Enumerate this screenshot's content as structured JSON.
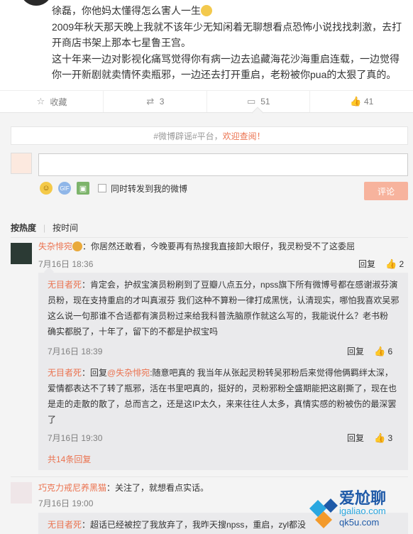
{
  "post": {
    "line1": "徐磊，你他妈太懂得怎么害人一生",
    "line2": "2009年秋天那天晚上我就不该年少无知闲着无聊想看点恐怖小说找找刺激，去打",
    "line3": "开商店书架上那本七星鲁王宫。",
    "line4": "这十年来一边对影视化痛骂觉得你有病一边去追藏海花沙海重启连载，一边觉得",
    "line5": "你一开新剧就卖情怀卖瓶邪，一边还去打开重启，老粉被你pua的太狠了真的。"
  },
  "actions": {
    "favorite": "收藏",
    "repost_count": "3",
    "comment_count": "51",
    "like_count": "41"
  },
  "hashtag": {
    "prefix": "#微博辟谣#平台，",
    "link": "欢迎查阅！"
  },
  "composer": {
    "repost_label": "同时转发到我的微博",
    "submit_label": "评论"
  },
  "sort": {
    "hot": "按热度",
    "time": "按时间"
  },
  "comments": [
    {
      "user": "失杂悱宛",
      "text": "：你居然还敢看，今晚要再有热搜我直接卸大眼仔，我灵粉受不了这委屈",
      "time": "7月16日 18:36",
      "reply": "回复",
      "likes": "2"
    },
    {
      "user": "无目者死",
      "text_a": "：肯定会，护叔宝演员粉刷到了豆瓣八点五分，npss旗下所有微博号都在感谢淑芬演",
      "text_b": "员粉，现在支持重启的才叫真淑芬 我们这种不算粉一律打成黑恍，认清现实，哪怕我喜欢吴邪",
      "text_c": "这么说一句那谁不合适都有演员粉过来给我科普洗脑原作就这么写的，我能说什么？老书粉",
      "text_d": "确实都脱了，十年了，留下的不都是护叔宝吗",
      "time": "7月16日 18:39",
      "reply": "回复",
      "likes": "6"
    },
    {
      "user": "无目者死",
      "reply_prefix": "：回复",
      "mention": "@失杂悱宛",
      "text_a": ":随意吧真的 我当年从张起灵粉转吴邪粉后来觉得他俩羁绊太深，",
      "text_b": "爱情都表达不了转了瓶邪，活在书里吧真的，挺好的，灵粉邪粉全盛期能把这剧撕了，现在也",
      "text_c": "是走的走散的散了，总而言之，还是这IP太久，来来往往人太多，真情实感的粉被伤的最深罢",
      "text_d": "了",
      "time": "7月16日 19:30",
      "reply": "回复",
      "likes": "3"
    },
    {
      "more": "共14条回复"
    },
    {
      "user": "巧克力戒尼养黑猫",
      "text": "：关注了，就想看点实话。",
      "time": "7月16日 19:00"
    },
    {
      "user": "无目者死",
      "text": "：超话已经被控了我放弃了，我昨天搜npss，重启，zyl都没"
    }
  ],
  "watermark": {
    "brand": "爱尬聊",
    "domain": "igaliao.com",
    "domain2": "qk5u.com"
  },
  "colors": {
    "accent": "#eb7350",
    "panel": "#f4f4f4",
    "reply_panel": "#eaeaec",
    "submit_disabled": "#f7b39d"
  }
}
